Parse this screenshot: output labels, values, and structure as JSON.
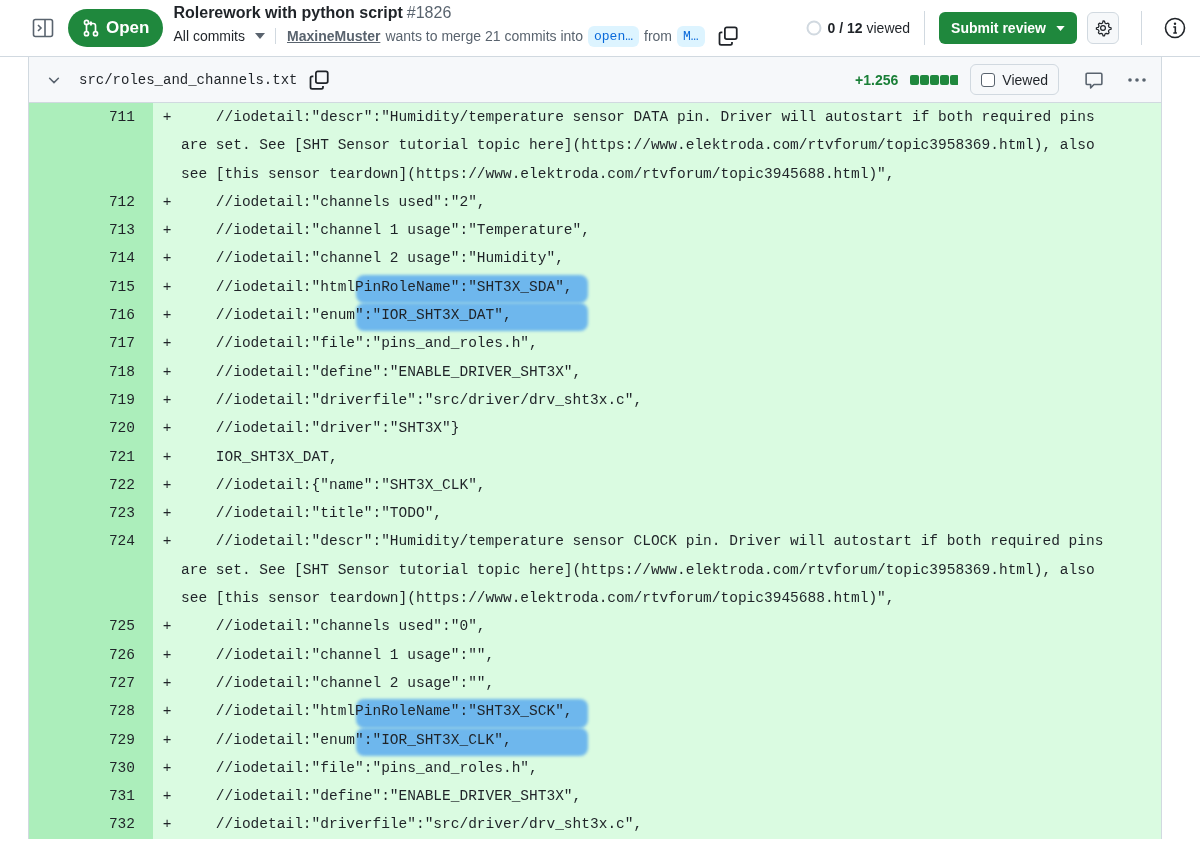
{
  "header": {
    "status": "Open",
    "title": "Rolerework with python script",
    "number": "#1826",
    "commits_menu": "All commits",
    "author": "MaxineMuster",
    "merge_text": "wants to merge 21 commits into",
    "base_branch": "open…",
    "from_text": "from",
    "head_branch": "M…",
    "viewed_count": "0 / 12",
    "viewed_label": "viewed",
    "submit": "Submit review"
  },
  "file": {
    "path": "src/roles_and_channels.txt",
    "additions": "+1.256",
    "viewed_label": "Viewed",
    "viewed": false,
    "expanded": true
  },
  "lines": [
    {
      "number": "711",
      "sign": "+",
      "code": "    //iodetail:\"descr\":\"Humidity/temperature sensor DATA pin. Driver will autostart if both required pins are set. See [SHT Sensor tutorial topic here](https://www.elektroda.com/rtvforum/topic3958369.html), also see [this sensor teardown](https://www.elektroda.com/rtvforum/topic3945688.html)\",",
      "marked": false
    },
    {
      "number": "712",
      "sign": "+",
      "code": "    //iodetail:\"channels used\":\"2\",",
      "marked": false
    },
    {
      "number": "713",
      "sign": "+",
      "code": "    //iodetail:\"channel 1 usage\":\"Temperature\",",
      "marked": false
    },
    {
      "number": "714",
      "sign": "+",
      "code": "    //iodetail:\"channel 2 usage\":\"Humidity\",",
      "marked": false
    },
    {
      "number": "715",
      "sign": "+",
      "code": "    //iodetail:\"htmlPinRoleName\":\"SHT3X_SDA\",",
      "marked": true
    },
    {
      "number": "716",
      "sign": "+",
      "code": "    //iodetail:\"enum\":\"IOR_SHT3X_DAT\",",
      "marked": true
    },
    {
      "number": "717",
      "sign": "+",
      "code": "    //iodetail:\"file\":\"pins_and_roles.h\",",
      "marked": false
    },
    {
      "number": "718",
      "sign": "+",
      "code": "    //iodetail:\"define\":\"ENABLE_DRIVER_SHT3X\",",
      "marked": false
    },
    {
      "number": "719",
      "sign": "+",
      "code": "    //iodetail:\"driverfile\":\"src/driver/drv_sht3x.c\",",
      "marked": false
    },
    {
      "number": "720",
      "sign": "+",
      "code": "    //iodetail:\"driver\":\"SHT3X\"}",
      "marked": false
    },
    {
      "number": "721",
      "sign": "+",
      "code": "    IOR_SHT3X_DAT,",
      "marked": false
    },
    {
      "number": "722",
      "sign": "+",
      "code": "    //iodetail:{\"name\":\"SHT3X_CLK\",",
      "marked": false
    },
    {
      "number": "723",
      "sign": "+",
      "code": "    //iodetail:\"title\":\"TODO\",",
      "marked": false
    },
    {
      "number": "724",
      "sign": "+",
      "code": "    //iodetail:\"descr\":\"Humidity/temperature sensor CLOCK pin. Driver will autostart if both required pins are set. See [SHT Sensor tutorial topic here](https://www.elektroda.com/rtvforum/topic3958369.html), also see [this sensor teardown](https://www.elektroda.com/rtvforum/topic3945688.html)\",",
      "marked": false
    },
    {
      "number": "725",
      "sign": "+",
      "code": "    //iodetail:\"channels used\":\"0\",",
      "marked": false
    },
    {
      "number": "726",
      "sign": "+",
      "code": "    //iodetail:\"channel 1 usage\":\"\",",
      "marked": false
    },
    {
      "number": "727",
      "sign": "+",
      "code": "    //iodetail:\"channel 2 usage\":\"\",",
      "marked": false
    },
    {
      "number": "728",
      "sign": "+",
      "code": "    //iodetail:\"htmlPinRoleName\":\"SHT3X_SCK\",",
      "marked": true
    },
    {
      "number": "729",
      "sign": "+",
      "code": "    //iodetail:\"enum\":\"IOR_SHT3X_CLK\",",
      "marked": true
    },
    {
      "number": "730",
      "sign": "+",
      "code": "    //iodetail:\"file\":\"pins_and_roles.h\",",
      "marked": false
    },
    {
      "number": "731",
      "sign": "+",
      "code": "    //iodetail:\"define\":\"ENABLE_DRIVER_SHT3X\",",
      "marked": false
    },
    {
      "number": "732",
      "sign": "+",
      "code": "    //iodetail:\"driverfile\":\"src/driver/drv_sht3x.c\",",
      "marked": false
    }
  ]
}
